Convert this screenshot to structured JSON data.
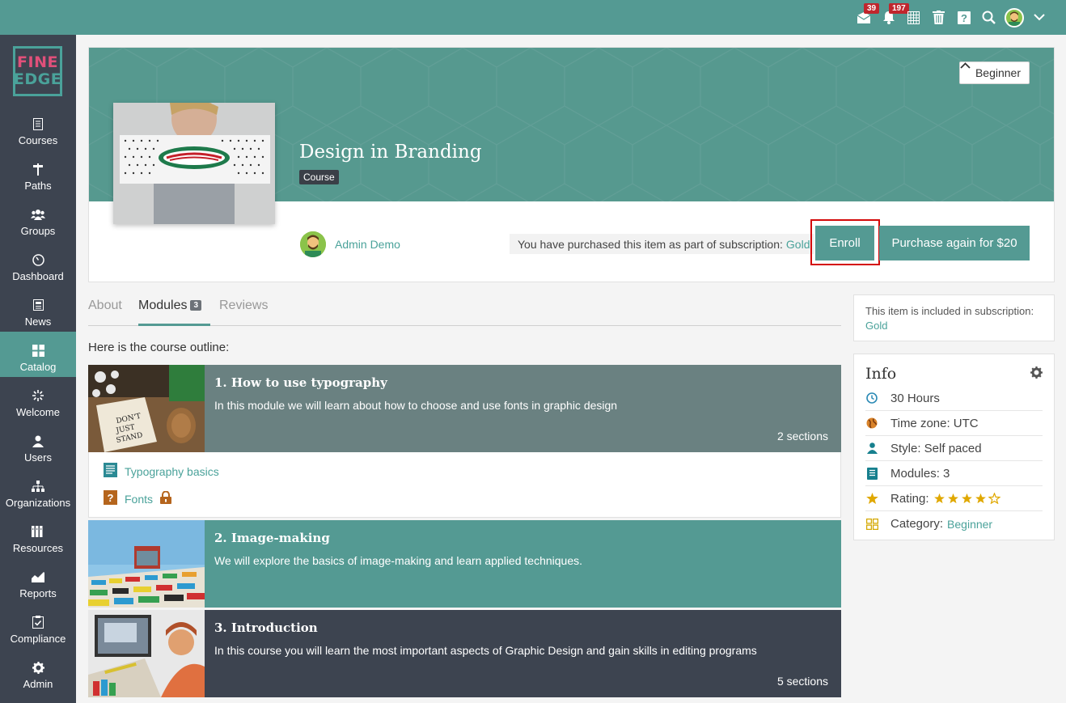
{
  "topbar": {
    "icons": [
      "mail-icon",
      "bell-icon",
      "calendar-icon",
      "trash-icon",
      "help-icon",
      "search-icon",
      "avatar",
      "chevron-down-icon"
    ],
    "mail_badge": "39",
    "bell_badge": "197"
  },
  "sidebar": {
    "logo_line1": "FINE",
    "logo_line2": "EDGE",
    "items": [
      {
        "label": "Courses",
        "icon": "book-icon"
      },
      {
        "label": "Paths",
        "icon": "signpost-icon"
      },
      {
        "label": "Groups",
        "icon": "users-icon"
      },
      {
        "label": "Dashboard",
        "icon": "gauge-icon"
      },
      {
        "label": "News",
        "icon": "newspaper-icon"
      },
      {
        "label": "Catalog",
        "icon": "grid-icon",
        "active": true
      },
      {
        "label": "Welcome",
        "icon": "sparkle-icon"
      },
      {
        "label": "Users",
        "icon": "user-icon"
      },
      {
        "label": "Organizations",
        "icon": "org-chart-icon"
      },
      {
        "label": "Resources",
        "icon": "library-icon"
      },
      {
        "label": "Reports",
        "icon": "chart-icon"
      },
      {
        "label": "Compliance",
        "icon": "clipboard-check-icon"
      },
      {
        "label": "Admin",
        "icon": "gear-icon"
      }
    ]
  },
  "course": {
    "level_label": "Beginner",
    "title": "Design in Branding",
    "tag": "Course",
    "author": "Admin Demo",
    "subscription_note": "You have purchased this item as part of subscription:",
    "subscription_name": "Gold",
    "enroll_label": "Enroll",
    "purchase_label": "Purchase again for $20"
  },
  "tabs": {
    "about": "About",
    "modules": "Modules",
    "modules_count": "3",
    "reviews": "Reviews"
  },
  "outline_intro": "Here is the course outline:",
  "modules": [
    {
      "title": "1. How to use typography",
      "description": "In this module we will learn about how to choose and use fonts in graphic design",
      "sections": "2 sections",
      "color": "#6a8181",
      "items": [
        {
          "label": "Typography basics",
          "icon": "document-icon"
        },
        {
          "label": "Fonts",
          "icon": "quiz-icon",
          "locked": true
        }
      ]
    },
    {
      "title": "2. Image-making",
      "description": "We will explore the basics of image-making and learn applied techniques.",
      "sections": "",
      "color": "#549a93"
    },
    {
      "title": "3. Introduction",
      "description": "In this course you will learn the most important aspects of Graphic Design and gain skills in editing programs",
      "sections": "5 sections",
      "color": "#3d4450"
    }
  ],
  "right": {
    "included_text": "This item is included in subscription:",
    "included_name": "Gold",
    "info_title": "Info",
    "info": {
      "duration": "30 Hours",
      "timezone": "Time zone: UTC",
      "style": "Style: Self paced",
      "modules": "Modules: 3",
      "rating_label": "Rating:",
      "rating_value": 4,
      "rating_max": 5,
      "category_label": "Category:",
      "category_value": "Beginner"
    }
  },
  "colors": {
    "accent": "#549a93",
    "sidebar": "#3d4450",
    "badge": "#c0262d",
    "highlight_border": "#d40a0a",
    "star": "#e0a800"
  }
}
